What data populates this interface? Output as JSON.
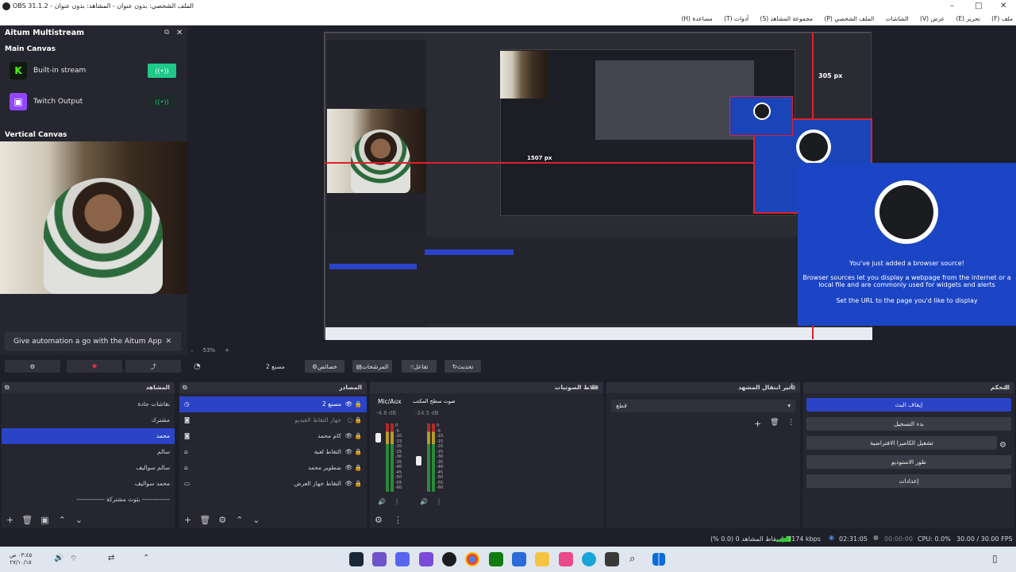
{
  "window": {
    "title": "OBS 31.1.2 - الملف الشخصي: بدون عنوان - المشاهد: بدون عنوان"
  },
  "menubar": [
    "ملف (F)",
    "تحرير (E)",
    "عرض (V)",
    "الشاشات",
    "الملف الشخصي (P)",
    "مجموعة المشاهد (S)",
    "أدوات (T)",
    "مساعدة (H)"
  ],
  "dock": {
    "title": "Aitum Multistream",
    "main_canvas": "Main Canvas",
    "outputs": [
      {
        "name": "Built-in stream",
        "icon": "kick-icon",
        "color": "#53fc18",
        "active": true
      },
      {
        "name": "Twitch Output",
        "icon": "twitch-icon",
        "color": "#9146ff",
        "active": false
      }
    ],
    "vertical_canvas": "Vertical Canvas",
    "promo": "Give automation a go with the Aitum App",
    "promo_close": "✕"
  },
  "preview": {
    "px_label_1": "305 px",
    "px_label_2": "1507 px"
  },
  "popup": {
    "line1": "You've just added a browser source!",
    "line2": "Browser sources let you display a webpage from the internet or a local file and are commonly used for widgets and alerts",
    "line3": "Set the URL to the page you'd like to display"
  },
  "zoom": "53%",
  "toolbar": {
    "source_name": "مصنع 2",
    "properties": "خصائص",
    "filters": "المرشحات",
    "interact": "تفاعل",
    "refresh": "تحديث"
  },
  "scenes": {
    "title": "المشاهد",
    "items": [
      {
        "label": "نقاشات جادة",
        "selected": false
      },
      {
        "label": "مشترك",
        "selected": false
      },
      {
        "label": "محمد",
        "selected": true
      },
      {
        "label": "سالم",
        "selected": false
      },
      {
        "label": "سالم سواليف",
        "selected": false
      },
      {
        "label": "محمد سواليف",
        "selected": false
      },
      {
        "label": "------------- بثوث مشتركة -------------",
        "selected": false
      }
    ]
  },
  "sources": {
    "title": "المصادر",
    "items": [
      {
        "label": "مصنع 2",
        "selected": true
      },
      {
        "label": "جهاز التقاط الفيديو",
        "selected": false
      },
      {
        "label": "كام محمد",
        "selected": false
      },
      {
        "label": "التقاط لعبة",
        "selected": false
      },
      {
        "label": "ضطوير محمد",
        "selected": false
      },
      {
        "label": "التقاط جهاز العرض",
        "selected": false
      }
    ]
  },
  "mixer": {
    "title": "خلاط الصوتيات",
    "channels": [
      {
        "name": "Mic/Aux",
        "db": "-4.6 dB",
        "level": 0.62
      },
      {
        "name": "صوت سطح المكتب",
        "db": "-24.5 dB",
        "level": 0.4
      }
    ],
    "scale": [
      "0",
      "-5",
      "-10",
      "-15",
      "-20",
      "-25",
      "-30",
      "-35",
      "-40",
      "-45",
      "-50",
      "-55",
      "-60"
    ]
  },
  "transitions": {
    "title": "تأثير انتقال المشهد",
    "selected": "قطع"
  },
  "controls": {
    "title": "التحكم",
    "buttons": [
      {
        "label": "إيقاف البث",
        "active": true
      },
      {
        "label": "بدء التسجيل",
        "active": false
      },
      {
        "label": "تشغيل الكاميرا الافتراضية",
        "active": false
      },
      {
        "label": "طور الاستوديو",
        "active": false
      },
      {
        "label": "إعدادات",
        "active": false
      }
    ]
  },
  "status": {
    "dropped": "إسقاط المشاهد 0 (0.0 %)",
    "bitrate": "7174 kbps",
    "stream_time": "02:31:05",
    "rec_time": "00:00:00",
    "cpu": "CPU: 0.0%",
    "fps": "30.00 / 30.00 FPS"
  },
  "taskbar": {
    "clock_time": "٠٣:٤٥ ص",
    "clock_date": "٢٧/١٠/١٥"
  }
}
